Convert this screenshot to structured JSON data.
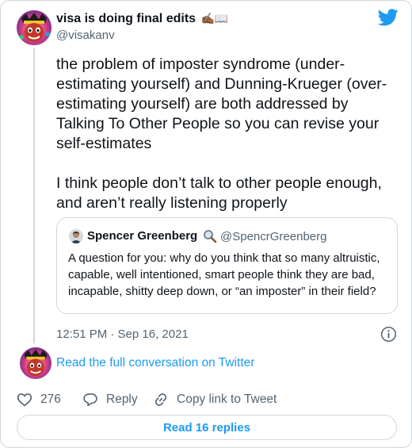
{
  "tweet": {
    "author_name": "visa is doing final edits",
    "author_emoji": "✍🏾📖",
    "author_handle": "@visakanv",
    "text": "the problem of imposter syndrome (under-estimating yourself) and Dunning-Krueger (over-estimating yourself) are both addressed by Talking To Other People so you can revise your self-estimates\n\nI think people don’t talk to other people enough, and aren’t really listening properly",
    "timestamp": "12:51 PM · Sep 16, 2021"
  },
  "quoted_tweet": {
    "author_name": "Spencer Greenberg",
    "author_emoji_icon": "magnifying-glass-icon",
    "author_handle": "@SpencrGreenberg",
    "text": "A question for you: why do you think that so many altruistic, capable, well intentioned, smart people think they are bad, incapable, shitty deep down, or “an imposter” in their field?"
  },
  "conversation_link": "Read the full conversation on Twitter",
  "actions": {
    "like_count": "276",
    "reply_label": "Reply",
    "copy_label": "Copy link to Tweet"
  },
  "read_replies_label": "Read 16 replies",
  "colors": {
    "accent": "#1d9bf0",
    "secondary_text": "#536471",
    "border": "#cfd9de"
  }
}
